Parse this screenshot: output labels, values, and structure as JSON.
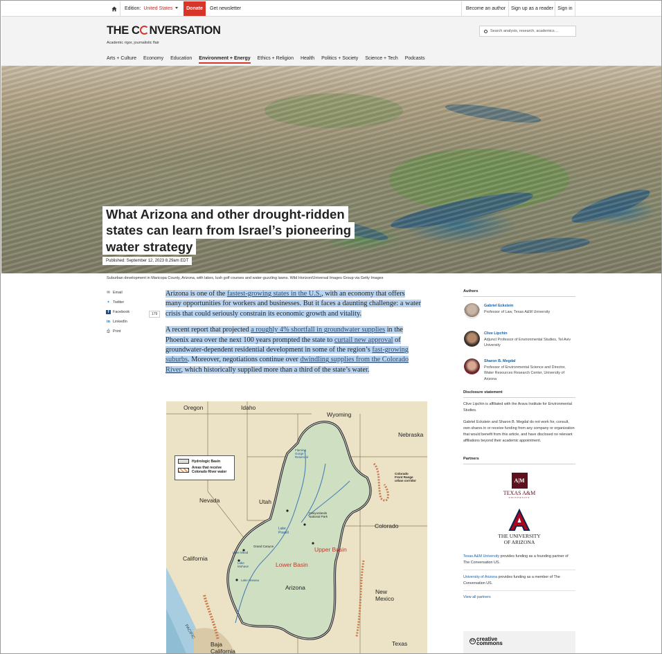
{
  "topbar": {
    "edition_label": "Edition:",
    "edition_value": "United States",
    "donate": "Donate",
    "newsletter": "Get newsletter",
    "become_author": "Become an author",
    "sign_up": "Sign up as a reader",
    "sign_in": "Sign in"
  },
  "header": {
    "logo_pre": "THE C",
    "logo_post": "NVERSATION",
    "tagline": "Academic rigor, journalistic flair",
    "search_placeholder": "Search analysis, research, academics…",
    "nav": [
      "Arts + Culture",
      "Economy",
      "Education",
      "Environment + Energy",
      "Ethics + Religion",
      "Health",
      "Politics + Society",
      "Science + Tech",
      "Podcasts"
    ],
    "nav_active": "Environment + Energy"
  },
  "hero": {
    "title_lines": [
      "What Arizona and other drought-ridden",
      "states can learn from Israel’s pioneering",
      "water strategy"
    ],
    "published": "Published: September 12, 2023 8.29am EDT",
    "caption": "Suburban development in Maricopa County, Arizona, with lakes, lush golf courses and water-guzzling lawns. Wild Horizon/Universal Images Group via Getty Images"
  },
  "share": {
    "email": "Email",
    "twitter": "Twitter",
    "facebook": "Facebook",
    "facebook_count": "179",
    "linkedin": "LinkedIn",
    "print": "Print"
  },
  "article": {
    "p1": {
      "a": "Arizona is one of the ",
      "link1": "fastest-growing states in the U.S.",
      "b": ", with an economy that offers many opportunities for workers and businesses. But it faces a daunting challenge: a water crisis that could seriously constrain its economic growth and vitality."
    },
    "p2": {
      "a": "A recent report that projected ",
      "link1": "a roughly 4% shortfall in groundwater supplies",
      "b": " in the Phoenix area over the next 100 years prompted the state to ",
      "link2": "curtail new approval",
      "c": " of groundwater-dependent residential development in some of the region’s ",
      "link3": "fast-growing suburbs",
      "d": ". Moreover, negotiations continue over ",
      "link4": "dwindling supplies from the Colorado River",
      "e": ", which historically supplied more than a third of the state’s water."
    }
  },
  "map": {
    "states": {
      "oregon": "Oregon",
      "idaho": "Idaho",
      "wyoming": "Wyoming",
      "nebraska": "Nebraska",
      "nevada": "Nevada",
      "utah": "Utah",
      "colorado": "Colorado",
      "california": "California",
      "arizona": "Arizona",
      "new_mexico": "New\nMexico",
      "texas": "Texas",
      "baja": "Baja\nCalifornia",
      "pacific": "PACIFIC"
    },
    "regions": {
      "upper": "Upper Basin",
      "lower": "Lower Basin"
    },
    "places": {
      "flaming": "Flaming\nGorge\nReservoir",
      "canyonlands": "Canyonlands\nNational Park",
      "lake_powell": "Lake\nPowell",
      "grand_canyon": "Grand Canyon",
      "lake_mead": "Lake Mead",
      "lake_mohave": "Lake\nMohave",
      "lake_havasu": "Lake Havasu",
      "front_range": "Colorado\nFront Range\nurban corridor"
    },
    "legend": [
      "Hydrologic Basin",
      "Areas that receive\nColorado River water"
    ]
  },
  "sidebar": {
    "authors_heading": "Authors",
    "authors": [
      {
        "name": "Gabriel Eckstein",
        "role": "Professor of Law, Texas A&M University"
      },
      {
        "name": "Clive Lipchin",
        "role": "Adjunct Professor of Environmental Studies, Tel Aviv University"
      },
      {
        "name": "Sharon B. Megdal",
        "role": "Professor of Environmental Science and Director, Water Resources Research Center, University of Arizona"
      }
    ],
    "disclosure_heading": "Disclosure statement",
    "disclosure_1": "Clive Lipchin is affiliated with the Arava Institute for Environmental Studies.",
    "disclosure_2": "Gabriel Eckstein and Sharon B. Megdal do not work for, consult, own shares in or receive funding from any company or organization that would benefit from this article, and have disclosed no relevant affiliations beyond their academic appointment.",
    "partners_heading": "Partners",
    "tamu_mark": "A|M",
    "tamu_name": "TEXAS A&M",
    "tamu_sub": "UNIVERSITY",
    "ua_line1": "THE UNIVERSITY",
    "ua_line2": "OF ARIZONA",
    "partner1_link": "Texas A&M University",
    "partner1_text": " provides funding as a founding partner of The Conversation US.",
    "partner2_link": "University of Arizona",
    "partner2_text": " provides funding as a member of The Conversation US.",
    "view_all": "View all partners",
    "cc_line1": "creative",
    "cc_line2": "commons",
    "cc_symbol": "cc"
  }
}
